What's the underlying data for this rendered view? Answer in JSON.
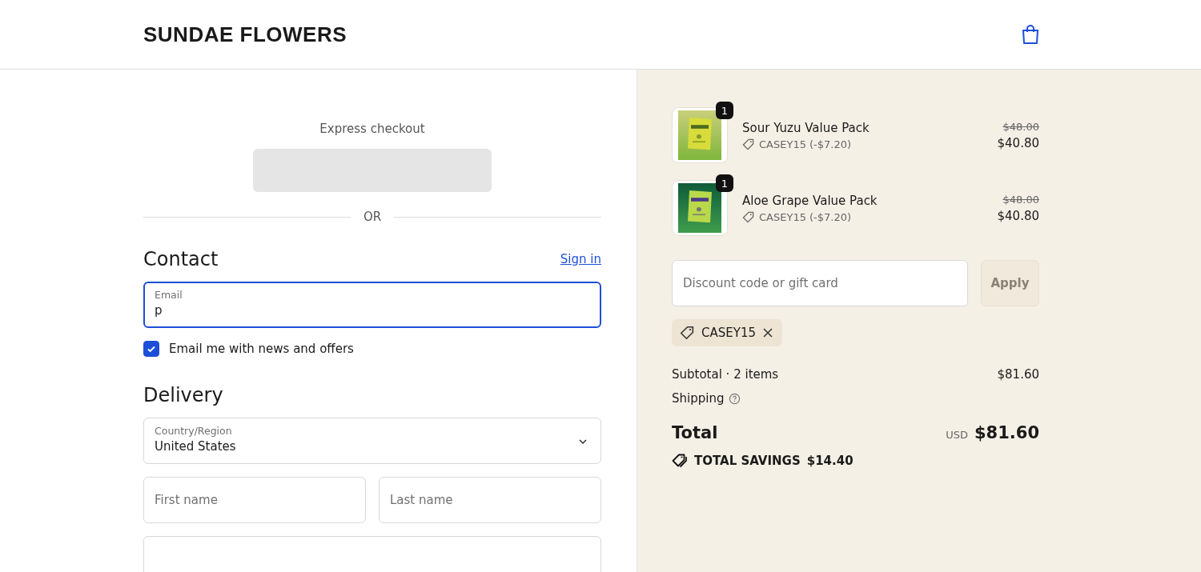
{
  "header": {
    "logo": "SUNDAE FLOWERS"
  },
  "express_checkout": {
    "label": "Express checkout",
    "divider": "OR"
  },
  "contact": {
    "title": "Contact",
    "sign_in": "Sign in",
    "email": {
      "label": "Email",
      "value": "p",
      "focused": true
    },
    "marketing": {
      "label": "Email me with news and offers",
      "checked": true
    }
  },
  "delivery": {
    "title": "Delivery",
    "country": {
      "label": "Country/Region",
      "value": "United States"
    },
    "first_name": {
      "placeholder": "First name"
    },
    "last_name": {
      "placeholder": "Last name"
    }
  },
  "order": {
    "items": [
      {
        "name": "Sour Yuzu Value Pack",
        "quantity": "1",
        "discount": "CASEY15 (-$7.20)",
        "original_price": "$48.00",
        "price": "$40.80",
        "kind": "picture"
      },
      {
        "name": "Aloe Grape Value Pack",
        "quantity": "1",
        "discount": "CASEY15 (-$7.20)",
        "original_price": "$48.00",
        "price": "$40.80",
        "kind": "picture"
      }
    ],
    "discount_field": {
      "placeholder": "Discount code or gift card"
    },
    "apply_button": {
      "label": "Apply",
      "disabled": true
    },
    "applied_code": "CASEY15",
    "subtotal_label": "Subtotal · 2 items",
    "subtotal": "$81.60",
    "shipping_label": "Shipping",
    "total_label": "Total",
    "currency": "USD",
    "total": "$81.60",
    "savings_label": "TOTAL SAVINGS",
    "savings": "$14.40"
  }
}
